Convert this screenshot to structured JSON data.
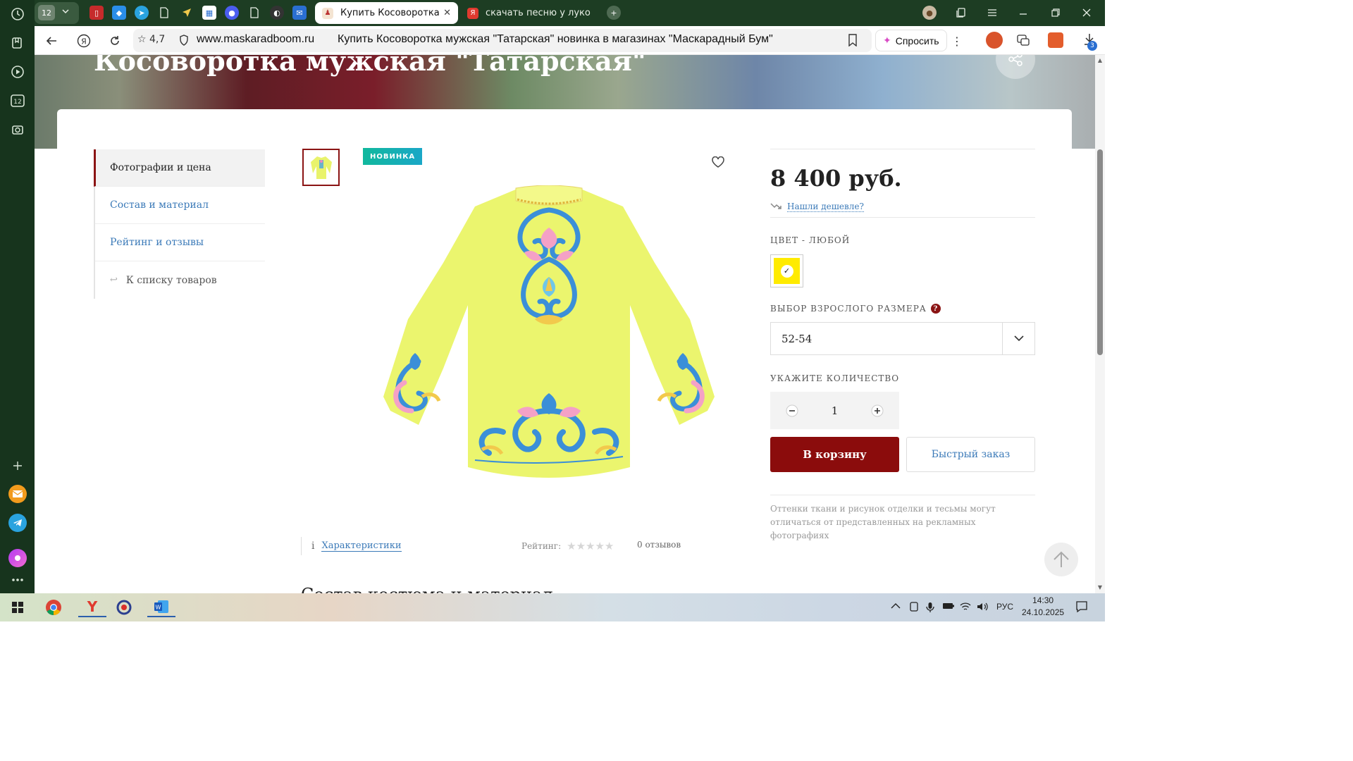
{
  "browser": {
    "sidebar_items": [
      "history-icon",
      "bookmarks-icon",
      "video-icon",
      "tabs-12-icon",
      "screenshot-icon",
      "add-icon",
      "mail-icon",
      "telegram-icon",
      "alice-icon",
      "more-icon"
    ],
    "tab_group_count": "12",
    "tabs": [
      {
        "label": "Купить Косоворотка м",
        "active": true
      },
      {
        "label": "скачать песню у лукомор",
        "active": false
      }
    ],
    "rating": "4,7",
    "domain": "www.maskaradboom.ru",
    "title": "Купить Косоворотка мужская \"Татарская\" новинка в магазинах \"Маскарадный Бум\"",
    "ask_label": "Спросить",
    "downloads_badge": "3"
  },
  "page": {
    "hero_title": "Косоворотка мужская \"Татарская\"",
    "nav": [
      "Фотографии и цена",
      "Состав и материал",
      "Рейтинг и отзывы",
      "К списку товаров"
    ],
    "badge": "НОВИНКА",
    "price": "8 400 руб.",
    "cheaper_link": "Нашли дешевле?",
    "color_label": "ЦВЕТ - ЛЮБОЙ",
    "color_swatch": "#ffeb00",
    "size_label": "ВЫБОР ВЗРОСЛОГО РАЗМЕРА",
    "size_value": "52-54",
    "qty_label": "УКАЖИТЕ КОЛИЧЕСТВО",
    "qty_value": "1",
    "add_to_cart": "В корзину",
    "quick_order": "Быстрый заказ",
    "note": "Оттенки ткани и рисунок отделки и тесьмы могут отличаться от представленных на рекламных фотографиях",
    "characteristics": "Характеристики",
    "rating_label": "Рейтинг:",
    "reviews": "0 отзывов",
    "section_heading": "Состав костюма и материал"
  },
  "taskbar": {
    "lang": "РУС",
    "time": "14:30",
    "date": "24.10.2025"
  },
  "colors": {
    "accent": "#8b0c0c",
    "link": "#3b7ab8",
    "badge": "#11b89d"
  }
}
